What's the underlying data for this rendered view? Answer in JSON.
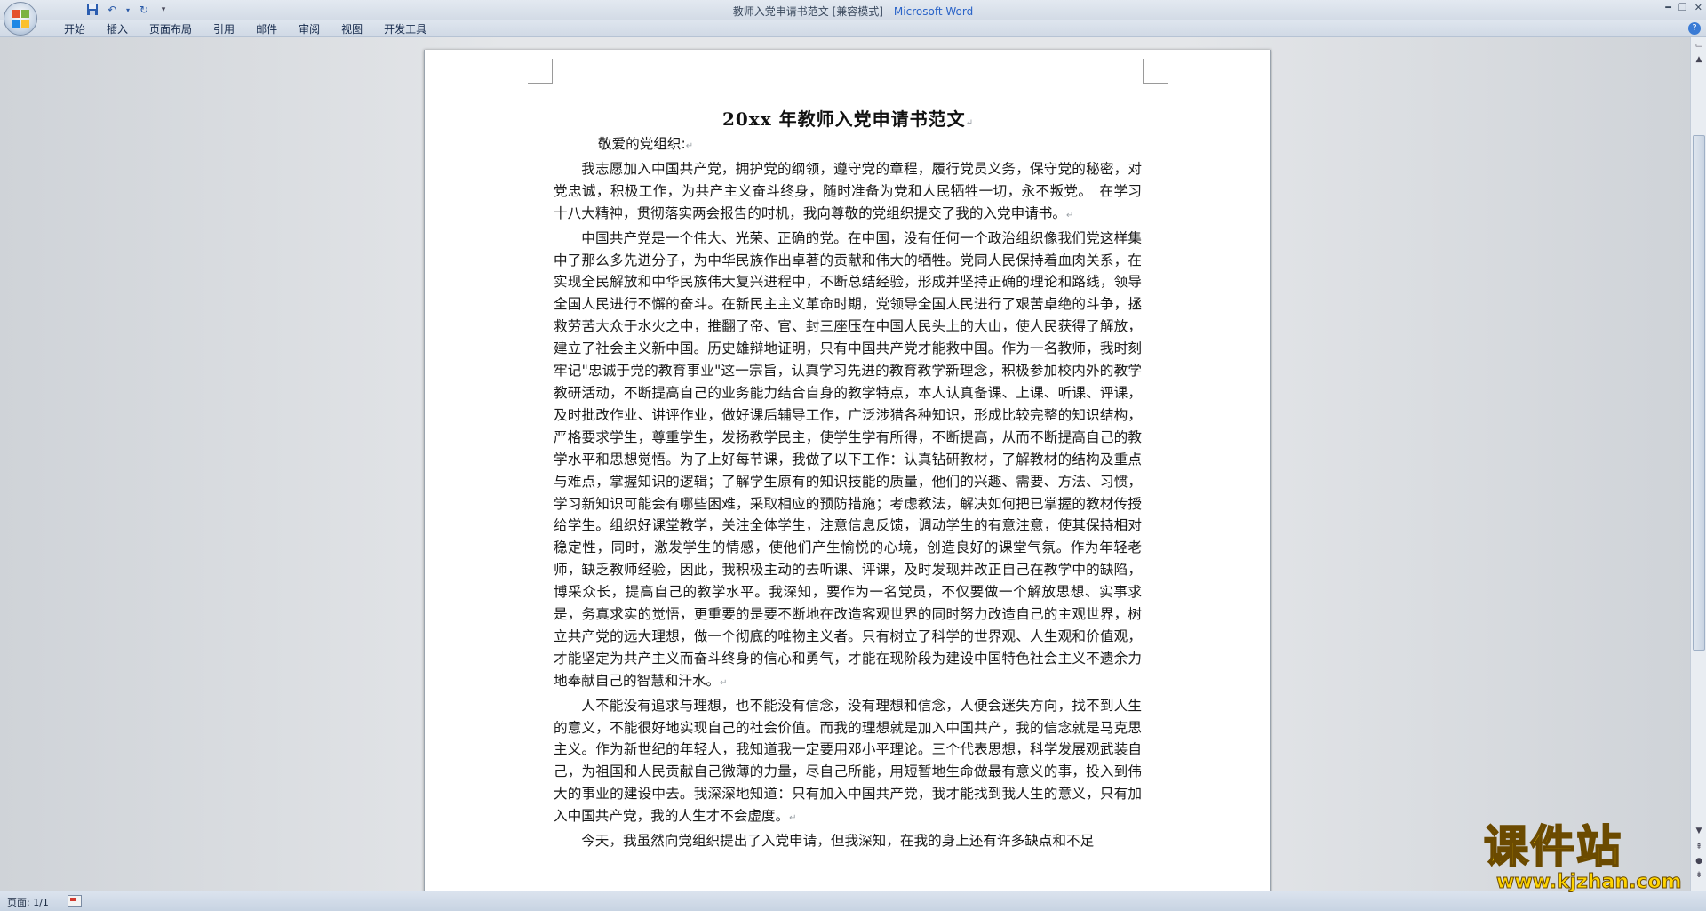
{
  "window": {
    "title_doc": "教师入党申请书范文 [兼容模式] - ",
    "title_app": "Microsoft Word"
  },
  "ribbon": {
    "tabs": [
      "开始",
      "插入",
      "页面布局",
      "引用",
      "邮件",
      "审阅",
      "视图",
      "开发工具"
    ]
  },
  "document": {
    "title": "20xx 年教师入党申请书范文",
    "salutation": "敬爱的党组织:",
    "paragraphs": [
      "我志愿加入中国共产党，拥护党的纲领，遵守党的章程，履行党员义务，保守党的秘密，对党忠诚，积极工作，为共产主义奋斗终身，随时准备为党和人民牺牲一切，永不叛党。　在学习十八大精神，贯彻落实两会报告的时机，我向尊敬的党组织提交了我的入党申请书。",
      "中国共产党是一个伟大、光荣、正确的党。在中国，没有任何一个政治组织像我们党这样集中了那么多先进分子，为中华民族作出卓著的贡献和伟大的牺牲。党同人民保持着血肉关系，在实现全民解放和中华民族伟大复兴进程中，不断总结经验，形成并坚持正确的理论和路线，领导全国人民进行不懈的奋斗。在新民主主义革命时期，党领导全国人民进行了艰苦卓绝的斗争，拯救劳苦大众于水火之中，推翻了帝、官、封三座压在中国人民头上的大山，使人民获得了解放，建立了社会主义新中国。历史雄辩地证明，只有中国共产党才能救中国。作为一名教师，我时刻牢记\"忠诚于党的教育事业\"这一宗旨，认真学习先进的教育教学新理念，积极参加校内外的教学教研活动，不断提高自己的业务能力结合自身的教学特点，本人认真备课、上课、听课、评课，及时批改作业、讲评作业，做好课后辅导工作，广泛涉猎各种知识，形成比较完整的知识结构，严格要求学生，尊重学生，发扬教学民主，使学生学有所得，不断提高，从而不断提高自己的教学水平和思想觉悟。为了上好每节课，我做了以下工作：认真钻研教材，了解教材的结构及重点与难点，掌握知识的逻辑；了解学生原有的知识技能的质量，他们的兴趣、需要、方法、习惯，学习新知识可能会有哪些困难，采取相应的预防措施；考虑教法，解决如何把已掌握的教材传授给学生。组织好课堂教学，关注全体学生，注意信息反馈，调动学生的有意注意，使其保持相对稳定性，同时，激发学生的情感，使他们产生愉悦的心境，创造良好的课堂气氛。作为年轻老师，缺乏教师经验，因此，我积极主动的去听课、评课，及时发现并改正自己在教学中的缺陷，博采众长，提高自己的教学水平。我深知，要作为一名党员，不仅要做一个解放思想、实事求是，务真求实的觉悟，更重要的是要不断地在改造客观世界的同时努力改造自己的主观世界，树立共产党的远大理想，做一个彻底的唯物主义者。只有树立了科学的世界观、人生观和价值观，才能坚定为共产主义而奋斗终身的信心和勇气，才能在现阶段为建设中国特色社会主义不遗余力地奉献自己的智慧和汗水。",
      "人不能没有追求与理想，也不能没有信念，没有理想和信念，人便会迷失方向，找不到人生的意义，不能很好地实现自己的社会价值。而我的理想就是加入中国共产，我的信念就是马克思主义。作为新世纪的年轻人，我知道我一定要用邓小平理论。三个代表思想，科学发展观武装自己，为祖国和人民贡献自己微薄的力量，尽自己所能，用短暂地生命做最有意义的事，投入到伟大的事业的建设中去。我深深地知道：只有加入中国共产党，我才能找到我人生的意义，只有加入中国共产党，我的人生才不会虚度。",
      "今天，我虽然向党组织提出了入党申请，但我深知，在我的身上还有许多缺点和不足"
    ]
  },
  "statusbar": {
    "page": "页面: 1/1"
  },
  "watermark": {
    "main": "课件站",
    "sub": "www.kjzhan.com"
  },
  "colors": {
    "accent": "#2a63c8",
    "watermark_fill": "#ffd500"
  }
}
